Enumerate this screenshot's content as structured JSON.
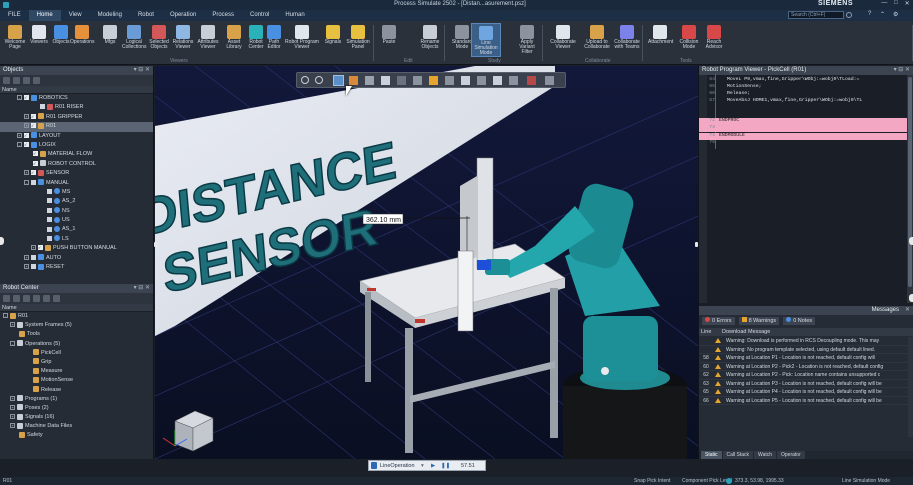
{
  "window": {
    "title": "Process Simulate 2502 - [Distan...asurement.psz]",
    "brand": "SIEMENS",
    "controls": [
      "—",
      "□",
      "✕"
    ]
  },
  "menu": {
    "items": [
      "FILE",
      "Home",
      "View",
      "Modeling",
      "Robot",
      "Operation",
      "Process",
      "Control",
      "Human"
    ],
    "active": "Home",
    "search_placeholder": "Search (Ctrl+F)"
  },
  "ribbon": {
    "buttons": [
      {
        "label": "Welcome Page",
        "icon": "home-icon",
        "color": "#d8a24a"
      },
      {
        "label": "Viewers",
        "icon": "viewers-icon",
        "color": "#e0e6ec"
      },
      {
        "label": "Objects",
        "icon": "objects-icon",
        "color": "#4a90e2"
      },
      {
        "label": "Operations",
        "icon": "operations-icon",
        "color": "#e7903c"
      },
      {
        "label": "Mfgs",
        "icon": "mfgs-icon",
        "color": "#c9ced6"
      },
      {
        "label": "Logical Collections",
        "icon": "logical-collections-icon",
        "color": "#6a9bd6"
      },
      {
        "label": "Selected Objects",
        "icon": "selected-objects-icon",
        "color": "#d45858"
      },
      {
        "label": "Relations Viewer",
        "icon": "relations-icon",
        "color": "#8fb7e3"
      },
      {
        "label": "Attributes Viewer",
        "icon": "attributes-icon",
        "color": "#c9ced6"
      },
      {
        "label": "Asset Library",
        "icon": "asset-library-icon",
        "color": "#d8a24a"
      },
      {
        "label": "Robot Center",
        "icon": "robot-center-icon",
        "color": "#29b3b8"
      },
      {
        "label": "Path Editor",
        "icon": "path-editor-icon",
        "color": "#4a90e2"
      },
      {
        "label": "Robot Program Viewer",
        "icon": "robot-program-icon",
        "color": "#e0e6ec"
      },
      {
        "label": "Signals",
        "icon": "signals-icon",
        "color": "#e8c040"
      },
      {
        "label": "Simulation Panel",
        "icon": "simulation-panel-icon",
        "color": "#e8c040"
      },
      {
        "label": "Paste",
        "icon": "paste-icon",
        "color": "#8a939e"
      },
      {
        "label": "Rename Objects",
        "icon": "rename-icon",
        "color": "#c9ced6"
      },
      {
        "label": "Standard Mode",
        "icon": "standard-mode-icon",
        "color": "#8a939e"
      },
      {
        "label": "Line Simulation Mode",
        "icon": "line-simulation-icon",
        "color": "#6fa6e0"
      },
      {
        "label": "Apply Variant Filter",
        "icon": "variant-filter-icon",
        "color": "#8a939e"
      },
      {
        "label": "Collaborate Viewer",
        "icon": "collaborate-viewer-icon",
        "color": "#e0e6ec"
      },
      {
        "label": "Upload to Collaborate",
        "icon": "upload-icon",
        "color": "#d8a24a"
      },
      {
        "label": "Collaborate with Teams",
        "icon": "teams-icon",
        "color": "#7b83eb"
      },
      {
        "label": "Attachment",
        "icon": "attachment-icon",
        "color": "#e0e6ec"
      },
      {
        "label": "Collision Mode",
        "icon": "collision-mode-icon",
        "color": "#d84848"
      },
      {
        "label": "Reach Advisor",
        "icon": "reach-advisor-icon",
        "color": "#d84848"
      }
    ],
    "groups": [
      "Viewers",
      "Edit",
      "Study",
      "Collaborate",
      "Tools"
    ]
  },
  "objects_panel": {
    "title": "Objects",
    "column": "Name",
    "rows": [
      {
        "label": "ROBOTICS",
        "indent": 2,
        "expand": "-",
        "check": true,
        "icon": "robotics-icon",
        "color": "#4a90e2"
      },
      {
        "label": "R01 RISER",
        "indent": 4,
        "expand": "",
        "check": false,
        "icon": "part-icon",
        "color": "#d45858"
      },
      {
        "label": "R01 GRIPPER",
        "indent": 3,
        "expand": "+",
        "check": true,
        "icon": "gripper-icon",
        "color": "#d8a24a"
      },
      {
        "label": "R01",
        "indent": 3,
        "expand": "+",
        "check": true,
        "icon": "robot-icon",
        "color": "#d8a24a",
        "selected": true
      },
      {
        "label": "LAYOUT",
        "indent": 2,
        "expand": "+",
        "check": true,
        "icon": "layout-icon",
        "color": "#4a90e2"
      },
      {
        "label": "LOGIX",
        "indent": 2,
        "expand": "-",
        "check": true,
        "icon": "logix-icon",
        "color": "#4a90e2"
      },
      {
        "label": "MATERIAL FLOW",
        "indent": 3,
        "expand": "",
        "check": true,
        "icon": "material-flow-icon",
        "color": "#d8a24a"
      },
      {
        "label": "ROBOT CONTROL",
        "indent": 3,
        "expand": "",
        "check": true,
        "icon": "robot-control-icon",
        "color": "#c9ced6"
      },
      {
        "label": "SENSOR",
        "indent": 3,
        "expand": "+",
        "check": true,
        "icon": "sensor-icon",
        "color": "#d45858"
      },
      {
        "label": "MANUAL",
        "indent": 3,
        "expand": "-",
        "check": false,
        "icon": "manual-icon",
        "color": "#4a90e2"
      },
      {
        "label": "MS",
        "indent": 5,
        "expand": "",
        "check": false,
        "icon": "signal-dot-icon",
        "color": "#4a90e2"
      },
      {
        "label": "AS_2",
        "indent": 5,
        "expand": "",
        "check": false,
        "icon": "signal-dot-icon",
        "color": "#4a90e2"
      },
      {
        "label": "NS",
        "indent": 5,
        "expand": "",
        "check": false,
        "icon": "signal-dot-icon",
        "color": "#4a90e2"
      },
      {
        "label": "US",
        "indent": 5,
        "expand": "",
        "check": false,
        "icon": "signal-dot-icon",
        "color": "#4a90e2"
      },
      {
        "label": "AS_1",
        "indent": 5,
        "expand": "",
        "check": false,
        "icon": "signal-dot-icon",
        "color": "#4a90e2"
      },
      {
        "label": "LS",
        "indent": 5,
        "expand": "",
        "check": false,
        "icon": "signal-dot-icon",
        "color": "#4a90e2"
      },
      {
        "label": "PUSH BUTTON MANUAL",
        "indent": 4,
        "expand": "+",
        "check": true,
        "icon": "push-button-icon",
        "color": "#d8a24a"
      },
      {
        "label": "AUTO",
        "indent": 3,
        "expand": "+",
        "check": false,
        "icon": "auto-icon",
        "color": "#4a90e2"
      },
      {
        "label": "RESET",
        "indent": 3,
        "expand": "+",
        "check": false,
        "icon": "reset-icon",
        "color": "#4a90e2"
      }
    ]
  },
  "robot_center": {
    "title": "Robot Center",
    "column": "Name",
    "rows": [
      {
        "label": "R01",
        "indent": 0,
        "expand": "-",
        "icon": "robot-icon",
        "color": "#d8a24a"
      },
      {
        "label": "System Frames (5)",
        "indent": 1,
        "expand": "+",
        "icon": "frames-icon",
        "color": "#c9ced6"
      },
      {
        "label": "Tools",
        "indent": 1,
        "expand": "",
        "icon": "tools-icon",
        "color": "#d8a24a"
      },
      {
        "label": "Operations (5)",
        "indent": 1,
        "expand": "-",
        "icon": "operations-icon",
        "color": "#c9ced6"
      },
      {
        "label": "PickCell",
        "indent": 3,
        "expand": "",
        "icon": "op-icon",
        "color": "#d8a24a"
      },
      {
        "label": "Grip",
        "indent": 3,
        "expand": "",
        "icon": "op-icon",
        "color": "#d8a24a"
      },
      {
        "label": "Measure",
        "indent": 3,
        "expand": "",
        "icon": "op-icon",
        "color": "#d8a24a"
      },
      {
        "label": "MotionSense",
        "indent": 3,
        "expand": "",
        "icon": "op-icon",
        "color": "#d8a24a"
      },
      {
        "label": "Release",
        "indent": 3,
        "expand": "",
        "icon": "op-icon",
        "color": "#d8a24a"
      },
      {
        "label": "Programs (1)",
        "indent": 1,
        "expand": "+",
        "icon": "programs-icon",
        "color": "#c9ced6"
      },
      {
        "label": "Poses (2)",
        "indent": 1,
        "expand": "+",
        "icon": "poses-icon",
        "color": "#c9ced6"
      },
      {
        "label": "Signals (16)",
        "indent": 1,
        "expand": "+",
        "icon": "signals-icon",
        "color": "#c9ced6"
      },
      {
        "label": "Machine Data Files",
        "indent": 1,
        "expand": "+",
        "icon": "data-files-icon",
        "color": "#c9ced6"
      },
      {
        "label": "Safety",
        "indent": 1,
        "expand": "",
        "icon": "safety-icon",
        "color": "#d8a24a"
      }
    ]
  },
  "viewport": {
    "wall_text_1": "DISTANCE",
    "wall_text_2": "SENSOR",
    "measurement": "362.10 mm",
    "operation_select": "LineOperation",
    "time": "57.51"
  },
  "rpv": {
    "title": "Robot Program Viewer - PickCell (R01)",
    "lines": [
      {
        "n": "64",
        "text": "MoveL P9,vmax,fine,Gripper\\WObj:=wobj0\\TLoad:=",
        "hl": false
      },
      {
        "n": "65",
        "text": "MotionSense;",
        "hl": false
      },
      {
        "n": "66",
        "text": "Release;",
        "hl": false
      },
      {
        "n": "67",
        "text": "MoveAbsJ HOME1,vmax,fine,Gripper\\WObj:=wobj0\\TL",
        "hl": false
      },
      {
        "n": "72",
        "text": "ENDPROC",
        "hl": true
      },
      {
        "n": "73",
        "text": "",
        "hl": true
      },
      {
        "n": "74",
        "text": "ENDMODULE",
        "hl": true
      },
      {
        "n": "75",
        "text": "",
        "hl": false
      }
    ]
  },
  "messages": {
    "title": "Messages",
    "tabs": {
      "errors": "0 Errors",
      "warnings": "8 Warnings",
      "notes": "0 Notes"
    },
    "columns": [
      "Line",
      "Download Message"
    ],
    "rows": [
      {
        "line": "",
        "text": "Warning: Download is performed in RCS Decoupling mode. This may"
      },
      {
        "line": "",
        "text": "Warning: No program template selected, using default default lined."
      },
      {
        "line": "58",
        "text": "Warning at Location P1 - Location is not reached, default config will"
      },
      {
        "line": "60",
        "text": "Warning at Location P2 - Pick2 - Location is not reached, default config"
      },
      {
        "line": "62",
        "text": "Warning at Location P2 - Pick: Location name contains unsupported c"
      },
      {
        "line": "63",
        "text": "Warning at Location P3 - Location is not reached, default config will be"
      },
      {
        "line": "65",
        "text": "Warning at Location P4 - Location is not reached, default config will be"
      },
      {
        "line": "66",
        "text": "Warning at Location P5 - Location is not reached, default config will be"
      }
    ],
    "bottom_tabs": [
      "Static",
      "Call Stack",
      "Watch",
      "Operator"
    ]
  },
  "status": {
    "left": "R01",
    "items": [
      "Snap Pick Intent",
      "Component Pick Level",
      "373.3, 53.98, 1995.33",
      "Line Simulation Mode"
    ]
  }
}
